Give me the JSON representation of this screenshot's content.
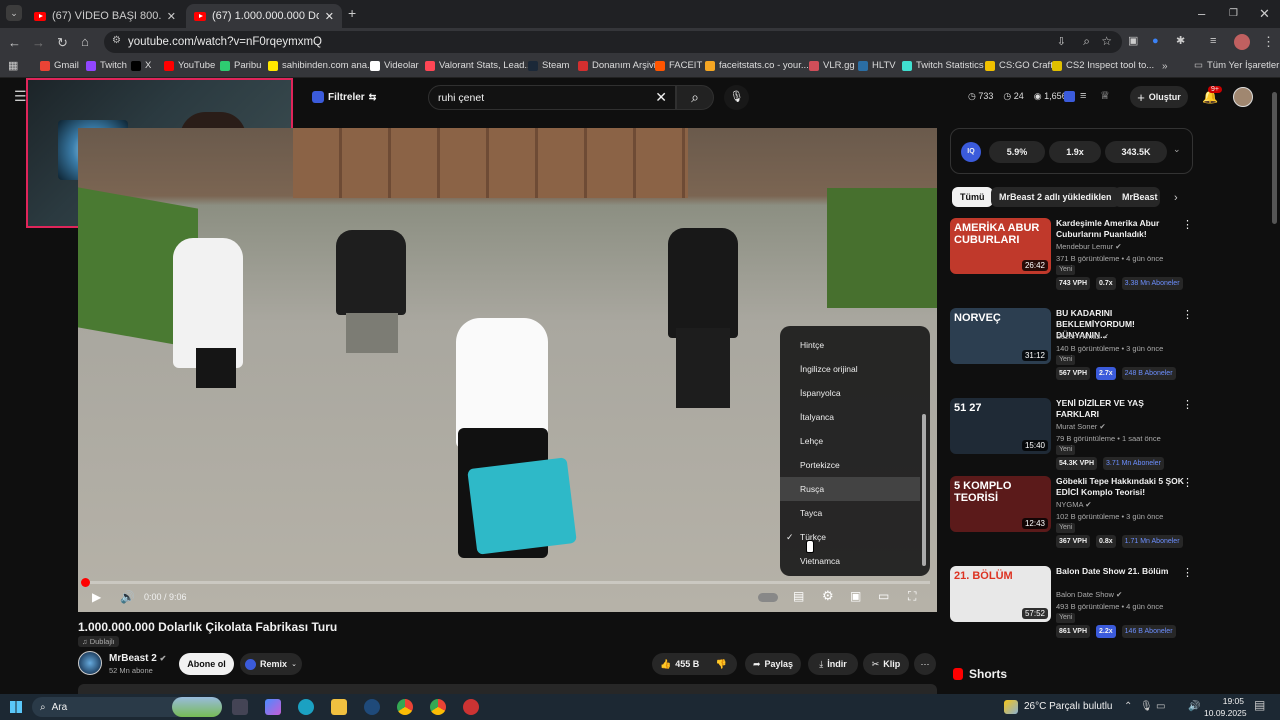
{
  "tabs": [
    {
      "label": "(67) VİDEO BAŞI 800.000 TL DU"
    },
    {
      "label": "(67) 1.000.000.000 Dolarlık Çiko"
    }
  ],
  "address": {
    "url": "youtube.com/watch?v=nF0rqeymxmQ"
  },
  "bookmarks": [
    {
      "label": "Gmail",
      "color": "#ea4335"
    },
    {
      "label": "Twitch",
      "color": "#9146ff"
    },
    {
      "label": "X",
      "color": "#000000"
    },
    {
      "label": "YouTube",
      "color": "#ff0000"
    },
    {
      "label": "Paribu",
      "color": "#2ecc71"
    },
    {
      "label": "sahibinden.com ana...",
      "color": "#ffe800"
    },
    {
      "label": "Videolar",
      "color": "#ffffff"
    },
    {
      "label": "Valorant Stats, Lead...",
      "color": "#ff4655"
    },
    {
      "label": "Steam",
      "color": "#1b2838"
    },
    {
      "label": "Donanım Arşivi",
      "color": "#d32f2f"
    },
    {
      "label": "FACEIT",
      "color": "#ff5500"
    },
    {
      "label": "faceitstats.co - your...",
      "color": "#f5a623"
    },
    {
      "label": "VLR.gg",
      "color": "#d04e59"
    },
    {
      "label": "HLTV",
      "color": "#2b6ea4"
    },
    {
      "label": "Twitch Statistics",
      "color": "#40e0d0"
    },
    {
      "label": "CS:GO Craft",
      "color": "#f0c000"
    },
    {
      "label": "CS2 Inspect tool to...",
      "color": "#e0c000"
    }
  ],
  "bookmarks_more": "Tüm Yer İşaretleri",
  "filters_label": "Filtreler",
  "search": {
    "value": "ruhi çenet"
  },
  "header_stats": {
    "a": "733",
    "b": "24",
    "c": "1,656"
  },
  "create_label": "Oluştur",
  "notif_count": "9+",
  "iq_stats": [
    "5.9%",
    "1.9x",
    "343.5K"
  ],
  "chips": [
    "Tümü",
    "MrBeast 2 adlı yüklediklen",
    "MrBeast"
  ],
  "language_menu": {
    "items": [
      "Hintçe",
      "İngilizce orijinal",
      "İspanyolca",
      "İtalyanca",
      "Lehçe",
      "Portekizce",
      "Rusça",
      "Tayca",
      "Türkçe",
      "Vietnamca"
    ],
    "selected": "Türkçe",
    "hovered": "Rusça"
  },
  "player": {
    "time": "0:00 / 9:06",
    "progress": 0.0
  },
  "video": {
    "title": "1.000.000.000 Dolarlık Çikolata Fabrikası Turu",
    "dubbed": "Dublajlı",
    "channel": "MrBeast 2",
    "subs": "52 Mn abone",
    "subscribe": "Abone ol",
    "remix": "Remix",
    "likes": "455 B",
    "share": "Paylaş",
    "download": "İndir",
    "clip": "Klip"
  },
  "related": [
    {
      "title1": "Kardeşimle Amerika Abur",
      "title2": "Cuburlarını Puanladık!",
      "channel": "Mendebur Lemur",
      "meta": "371 B görüntüleme • 4 gün önce",
      "badge": "Yeni",
      "vph": "743 VPH",
      "ratio": "0.7x",
      "subs": "3.38 Mn Aboneler",
      "duration": "26:42",
      "thumb_text": "AMERİKA ABUR CUBURLARI",
      "thumb_color": "#c0392b"
    },
    {
      "title1": "BU KADARINI",
      "title2": "BEKLEMİYORDUM! DÜNYANIN...",
      "channel": "Sezer Yılmaz",
      "meta": "140 B görüntüleme • 3 gün önce",
      "badge": "Yeni",
      "vph": "567 VPH",
      "ratio": "2.7x",
      "subs": "248 B Aboneler",
      "duration": "31:12",
      "thumb_text": "NORVEÇ",
      "thumb_color": "#2c3e50"
    },
    {
      "title1": "YENİ DİZİLER VE YAŞ FARKLARI",
      "title2": "",
      "channel": "Murat Soner",
      "meta": "79 B görüntüleme • 1 saat önce",
      "badge": "Yeni",
      "vph": "54.3K VPH",
      "ratio": "",
      "subs": "3.71 Mn Aboneler",
      "duration": "15:40",
      "thumb_text": "51 27",
      "thumb_color": "#1f2a36"
    },
    {
      "title1": "Göbekli Tepe Hakkındaki 5 ŞOK",
      "title2": "EDİCİ Komplo Teorisi!",
      "channel": "NYGMA",
      "meta": "102 B görüntüleme • 3 gün önce",
      "badge": "Yeni",
      "vph": "367 VPH",
      "ratio": "0.8x",
      "subs": "1.71 Mn Aboneler",
      "duration": "12:43",
      "thumb_text": "5 KOMPLO TEORİSİ",
      "thumb_color": "#5b1a1a"
    },
    {
      "title1": "Balon Date Show 21. Bölüm",
      "title2": "",
      "channel": "Balon Date Show",
      "meta": "493 B görüntüleme • 4 gün önce",
      "badge": "Yeni",
      "vph": "861 VPH",
      "ratio": "2.2x",
      "subs": "146 B Aboneler",
      "duration": "57:52",
      "thumb_text": "21. BÖLÜM",
      "thumb_color": "#e8e8e8"
    }
  ],
  "shorts_label": "Shorts",
  "taskbar": {
    "search": "Ara",
    "weather": "26°C  Parçalı bulutlu",
    "time": "19:05",
    "date": "10.09.2025"
  }
}
